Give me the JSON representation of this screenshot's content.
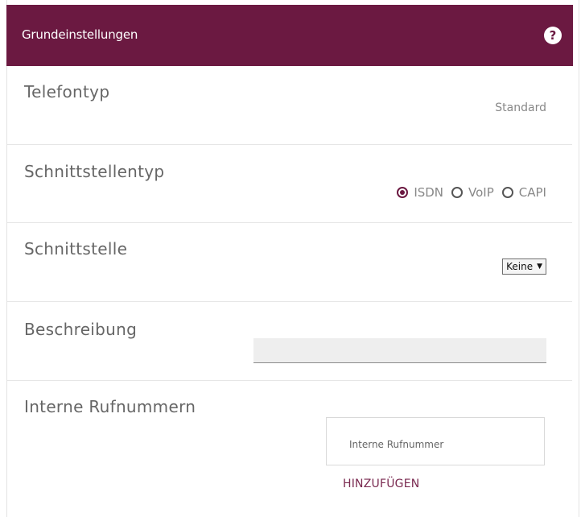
{
  "header": {
    "title": "Grundeinstellungen",
    "help_icon": "help-icon"
  },
  "rows": {
    "telefontyp": {
      "label": "Telefontyp",
      "value": "Standard"
    },
    "schnittstellentyp": {
      "label": "Schnittstellentyp",
      "options": [
        {
          "label": "ISDN",
          "selected": true
        },
        {
          "label": "VoIP",
          "selected": false
        },
        {
          "label": "CAPI",
          "selected": false
        }
      ]
    },
    "schnittstelle": {
      "label": "Schnittstelle",
      "select_value": "Keine"
    },
    "beschreibung": {
      "label": "Beschreibung",
      "value": ""
    },
    "interne_rufnummern": {
      "label": "Interne Rufnummern",
      "column_header": "Interne Rufnummer",
      "add_label": "HINZUFÜGEN"
    }
  },
  "colors": {
    "accent": "#6b1941",
    "link": "#7a2a50"
  }
}
